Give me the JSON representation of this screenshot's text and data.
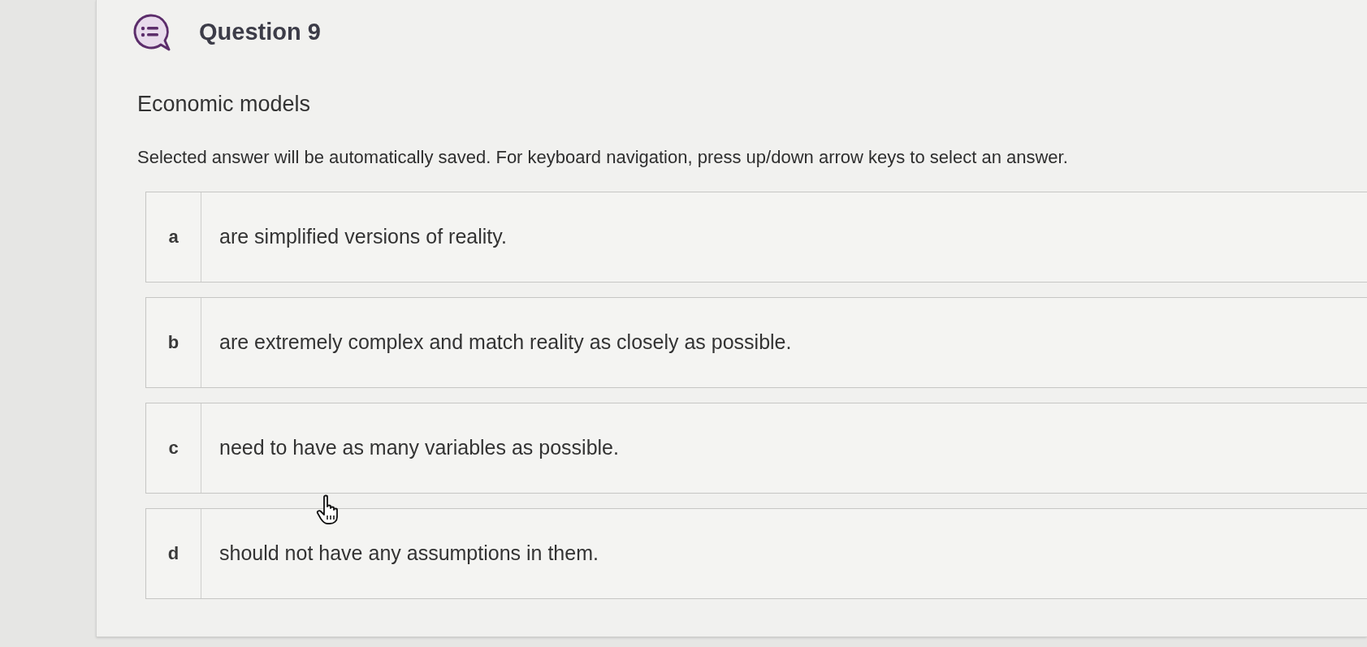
{
  "question": {
    "title": "Question 9",
    "prompt": "Economic models",
    "instruction": "Selected answer will be automatically saved. For keyboard navigation, press up/down arrow keys to select an answer."
  },
  "options": [
    {
      "letter": "a",
      "text": "are simplified versions of reality.",
      "selected": false
    },
    {
      "letter": "b",
      "text": "are extremely complex and match reality as closely as possible.",
      "selected": false
    },
    {
      "letter": "c",
      "text": "need to have as many variables as possible.",
      "selected": false
    },
    {
      "letter": "d",
      "text": "should not have any assumptions in them.",
      "selected": false
    }
  ]
}
